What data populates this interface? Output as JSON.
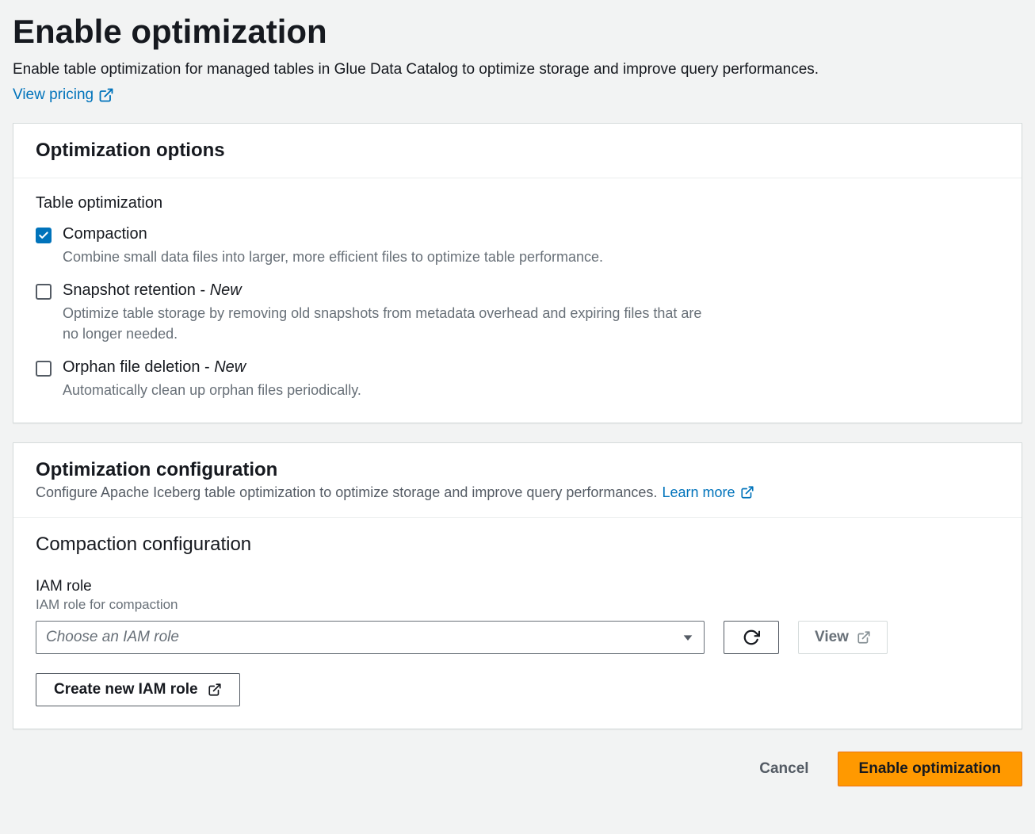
{
  "header": {
    "title": "Enable optimization",
    "subtitle": "Enable table optimization for managed tables in Glue Data Catalog to optimize storage and improve query performances.",
    "pricing_link": "View pricing"
  },
  "options_panel": {
    "title": "Optimization options",
    "section_label": "Table optimization",
    "items": [
      {
        "title": "Compaction",
        "desc": "Combine small data files into larger, more efficient files to optimize table performance.",
        "checked": true,
        "new": false
      },
      {
        "title": "Snapshot retention",
        "desc": "Optimize table storage by removing old snapshots from metadata overhead and expiring files that are no longer needed.",
        "checked": false,
        "new": true,
        "new_label": "New"
      },
      {
        "title": "Orphan file deletion",
        "desc": "Automatically clean up orphan files periodically.",
        "checked": false,
        "new": true,
        "new_label": "New"
      }
    ]
  },
  "config_panel": {
    "title": "Optimization configuration",
    "desc": "Configure Apache Iceberg table optimization to optimize storage and improve query performances.",
    "learn_more": "Learn more",
    "sub_title": "Compaction configuration",
    "iam": {
      "label": "IAM role",
      "help": "IAM role for compaction",
      "placeholder": "Choose an IAM role",
      "view_label": "View",
      "create_label": "Create new IAM role"
    }
  },
  "footer": {
    "cancel": "Cancel",
    "submit": "Enable optimization"
  },
  "sep": " - "
}
